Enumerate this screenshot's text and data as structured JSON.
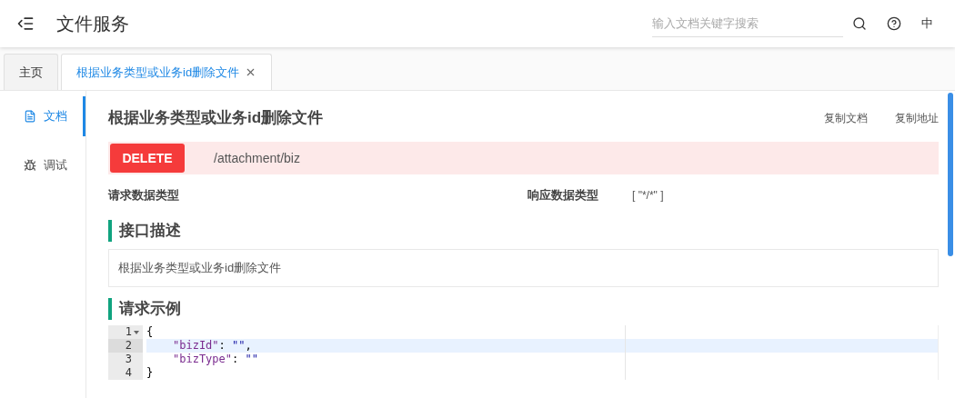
{
  "header": {
    "title": "文件服务",
    "search": {
      "placeholder": "输入文档关键字搜索"
    },
    "language": "中"
  },
  "tabs": [
    {
      "label": "主页",
      "selected": false,
      "closable": false
    },
    {
      "label": "根据业务类型或业务id删除文件",
      "selected": true,
      "closable": true
    }
  ],
  "sidebar": {
    "items": [
      {
        "kind": "doc",
        "label": "文档",
        "selected": true
      },
      {
        "kind": "debug",
        "label": "调试",
        "selected": false
      }
    ]
  },
  "doc": {
    "title": "根据业务类型或业务id删除文件",
    "actions": [
      "复制文档",
      "复制地址"
    ],
    "method": "DELETE",
    "path": "/attachment/biz",
    "request_type_label": "请求数据类型",
    "response_type_label": "响应数据类型",
    "response_type": "[ \"*/*\" ]",
    "description_heading": "接口描述",
    "description": "根据业务类型或业务id删除文件",
    "example_heading": "请求示例",
    "code_lines": [
      {
        "number": "1",
        "foldable": true,
        "active": false,
        "indented": false,
        "tokens": [
          {
            "kind": "punct",
            "text": "{"
          }
        ]
      },
      {
        "number": "2",
        "foldable": false,
        "active": true,
        "indented": true,
        "tokens": [
          {
            "kind": "key",
            "text": "\"bizId\""
          },
          {
            "kind": "punct",
            "text": ": "
          },
          {
            "kind": "string",
            "text": "\"\""
          },
          {
            "kind": "punct",
            "text": ","
          }
        ]
      },
      {
        "number": "3",
        "foldable": false,
        "active": false,
        "indented": true,
        "tokens": [
          {
            "kind": "key",
            "text": "\"bizType\""
          },
          {
            "kind": "punct",
            "text": ": "
          },
          {
            "kind": "string",
            "text": "\"\""
          }
        ]
      },
      {
        "number": "4",
        "foldable": false,
        "active": false,
        "indented": false,
        "tokens": [
          {
            "kind": "punct",
            "text": "}"
          }
        ]
      }
    ]
  }
}
